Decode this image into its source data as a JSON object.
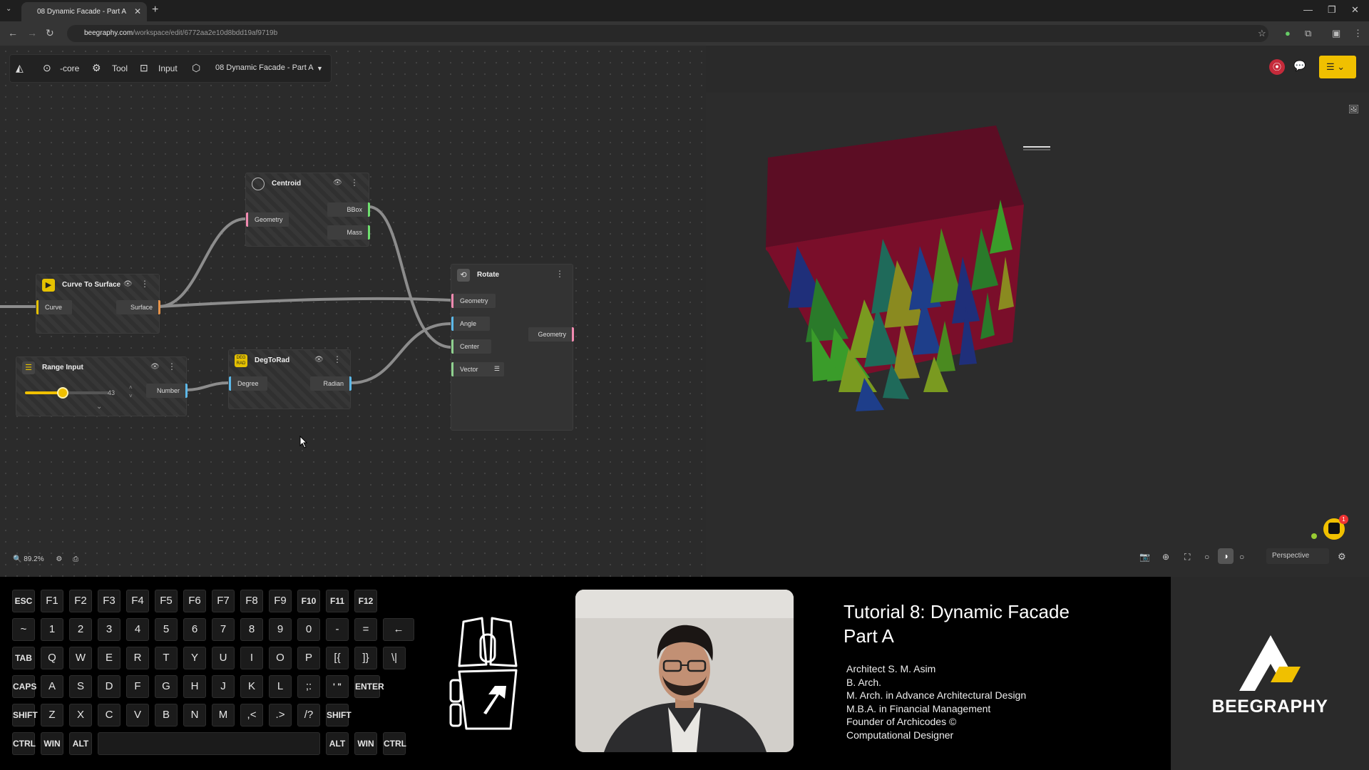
{
  "browser": {
    "tab_title": "08 Dynamic Facade - Part A",
    "url_host": "beegraphy.com",
    "url_path": "/workspace/edit/6772aa2e10d8bdd19af9719b"
  },
  "toolbar": {
    "core_label": "-core",
    "tool_label": "Tool",
    "input_label": "Input",
    "project_label": "08 Dynamic Facade - Part A"
  },
  "nodes": {
    "centroid": {
      "title": "Centroid",
      "in_geometry": "Geometry",
      "out_bbox": "BBox",
      "out_mass": "Mass"
    },
    "curve_to_surface": {
      "title": "Curve To Surface",
      "in_curve": "Curve",
      "out_surface": "Surface"
    },
    "rotate": {
      "title": "Rotate",
      "in_geometry": "Geometry",
      "in_angle": "Angle",
      "in_center": "Center",
      "in_vector": "Vector",
      "out_geometry": "Geometry"
    },
    "range_input": {
      "title": "Range Input",
      "value": "43",
      "value_fraction": 0.45,
      "out_number": "Number"
    },
    "degtorad": {
      "title": "DegToRad",
      "badge": "DEG RAD",
      "in_degree": "Degree",
      "out_radian": "Radian"
    }
  },
  "canvas": {
    "zoom": "89.2%"
  },
  "viewport": {
    "camera_mode": "Perspective",
    "notification_count": "1"
  },
  "keyboard": {
    "row1": [
      "ESC",
      "F1",
      "F2",
      "F3",
      "F4",
      "F5",
      "F6",
      "F7",
      "F8",
      "F9",
      "F10",
      "F11",
      "F12"
    ],
    "row2": [
      "~",
      "1",
      "2",
      "3",
      "4",
      "5",
      "6",
      "7",
      "8",
      "9",
      "0",
      "-",
      "=",
      "←"
    ],
    "row3": [
      "TAB",
      "Q",
      "W",
      "E",
      "R",
      "T",
      "Y",
      "U",
      "I",
      "O",
      "P",
      "[{",
      "]}",
      "\\|"
    ],
    "row4": [
      "CAPS",
      "A",
      "S",
      "D",
      "F",
      "G",
      "H",
      "J",
      "K",
      "L",
      ";:",
      "' \"",
      "ENTER"
    ],
    "row5": [
      "SHIFT",
      "Z",
      "X",
      "C",
      "V",
      "B",
      "N",
      "M",
      ",<",
      ".>",
      "/?",
      "SHIFT"
    ],
    "row6": [
      "CTRL",
      "WIN",
      "ALT",
      "",
      "ALT",
      "WIN",
      "CTRL"
    ]
  },
  "tutorial": {
    "title_line1": "Tutorial 8: Dynamic Facade",
    "title_line2": "Part A",
    "credits": [
      "Architect S. M. Asim",
      "B. Arch.",
      "M. Arch. in Advance Architectural Design",
      "M.B.A. in Financial Management",
      "Founder of Archicodes ©",
      "Computational Designer"
    ]
  },
  "brand": {
    "name": "BEEGRAPHY"
  },
  "colors": {
    "facade_red": "#7e0f2c",
    "facade_top": "#5c0d24",
    "accent_yellow": "#f0c000",
    "port_input": "#f18ab0",
    "port_output": "#6fe06f",
    "wire": "#8c8c8c"
  }
}
